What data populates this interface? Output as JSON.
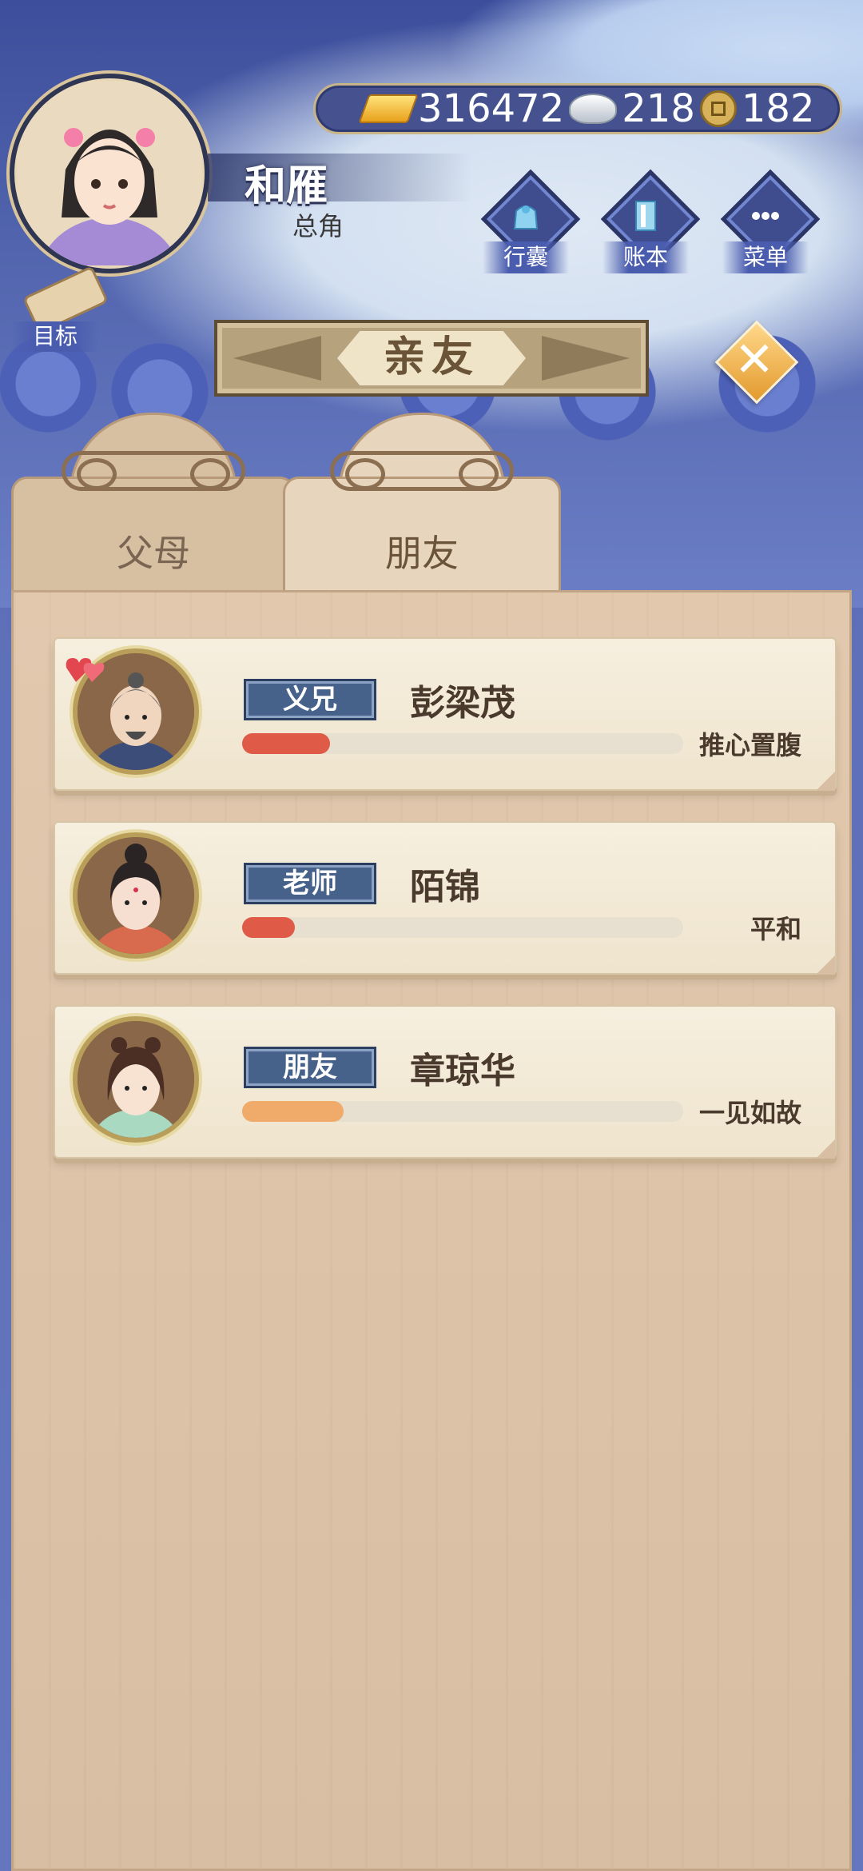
{
  "player": {
    "name": "和雁",
    "role": "总角"
  },
  "currency": {
    "gold": "316472",
    "silver": "218",
    "coins": "182"
  },
  "hud_buttons": [
    {
      "label": "行囊",
      "icon": "bag-icon"
    },
    {
      "label": "账本",
      "icon": "ledger-icon"
    },
    {
      "label": "菜单",
      "icon": "menu-dots-icon"
    }
  ],
  "target": {
    "label": "目标"
  },
  "title": "亲友",
  "tabs": [
    {
      "label": "父母",
      "active": false
    },
    {
      "label": "朋友",
      "active": true
    }
  ],
  "relations": [
    {
      "tag": "义兄",
      "name": "彭梁茂",
      "status": "推心置腹",
      "progress": 0.2,
      "bar_color": "#e05a48",
      "favorite": true
    },
    {
      "tag": "老师",
      "name": "陌锦",
      "status": "平和",
      "progress": 0.12,
      "bar_color": "#e05a48",
      "favorite": false
    },
    {
      "tag": "朋友",
      "name": "章琼华",
      "status": "一见如故",
      "progress": 0.23,
      "bar_color": "#f0aa6a",
      "favorite": false
    }
  ]
}
